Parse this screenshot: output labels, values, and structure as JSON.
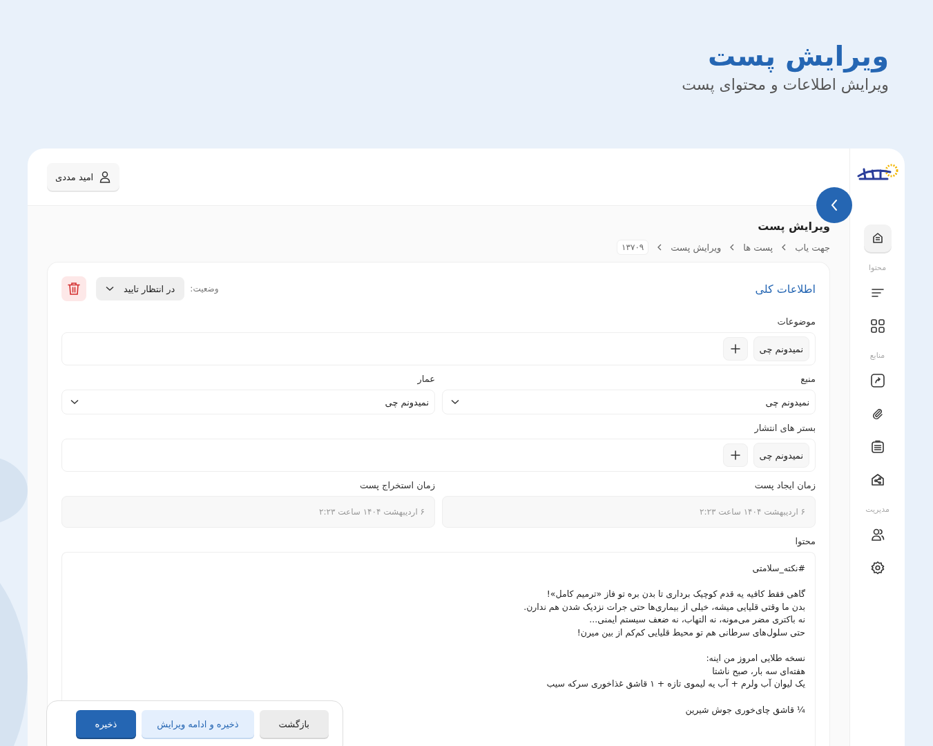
{
  "header": {
    "title": "ویرایش پست",
    "subtitle": "ویرایش اطلاعات و محتوای پست"
  },
  "sidebar": {
    "home": {
      "selected": true
    },
    "sections": [
      {
        "title": "محتوا",
        "items": [
          {
            "kind": "lines",
            "selected": false
          },
          {
            "kind": "grid",
            "selected": false
          }
        ]
      },
      {
        "title": "منابع",
        "items": [
          {
            "kind": "share",
            "selected": false
          },
          {
            "kind": "clip",
            "selected": false
          },
          {
            "kind": "list",
            "selected": false
          },
          {
            "kind": "house",
            "selected": false
          }
        ]
      },
      {
        "title": "مدیریت",
        "items": [
          {
            "kind": "users",
            "selected": false
          },
          {
            "kind": "gear",
            "selected": false
          }
        ]
      }
    ]
  },
  "user": {
    "name": "امید مددی"
  },
  "page": {
    "title": "ویرایش پست",
    "breadcrumb": [
      "جهت یاب",
      "پست ها",
      "ویرایش پست"
    ],
    "post_id": "۱۳۷۰۹"
  },
  "form": {
    "title": "اطلاعات کلی",
    "status": {
      "label": "وضعیت:",
      "value": "در انتظار تایید"
    },
    "rows": [
      [
        {
          "kind": "tags",
          "label": "موضوعات",
          "tags": [
            "نمیدونم چی"
          ]
        }
      ],
      [
        {
          "kind": "select",
          "label": "منبع",
          "value": "نمیدونم چی"
        },
        {
          "kind": "select",
          "label": "عمار",
          "value": "نمیدونم چی"
        }
      ],
      [
        {
          "kind": "tags",
          "label": "بستر های انتشار",
          "tags": [
            "نمیدونم چی"
          ]
        }
      ],
      [
        {
          "kind": "date",
          "label": "زمان ایجاد پست",
          "value": "۶ اردیبهشت ۱۴۰۴ ساعت ۲:۲۳",
          "disabled": true
        },
        {
          "kind": "date",
          "label": "زمان استخراج پست",
          "value": "۶ اردیبهشت ۱۴۰۴ ساعت ۲:۲۳",
          "disabled": true
        }
      ],
      [
        {
          "kind": "editor",
          "label": "محتوا",
          "paragraphs": [
            [
              "#نکته_سلامتی"
            ],
            [
              "گاهی فقط کافیه یه قدم کوچیک برداری تا بدن بره تو فاز «ترمیم کامل»!",
              "بدن ما وقتی قلیایی میشه، خیلی از بیماری‌ها حتی جرات نزدیک شدن هم ندارن.",
              "نه باکتری مضر می‌مونه، نه التهاب، نه ضعف سیستم ایمنی...",
              "حتی سلول‌های سرطانی هم تو محیط قلیایی کم‌کم از بین میرن!"
            ],
            [
              "نسخه طلایی امروز من اینه:",
              "هفته‌ای سه بار، صبح ناشتا",
              "یک لیوان آب ولرم + آب یه لیموی تازه + ۱ قاشق غذاخوری سرکه سیب"
            ],
            [
              "¼ قاشق چای‌خوری جوش شیرین"
            ]
          ]
        }
      ]
    ]
  },
  "footer": {
    "buttons": [
      {
        "kind": "secondary",
        "label": "بازگشت"
      },
      {
        "kind": "soft",
        "label": "ذخیره و ادامه ویرایش"
      },
      {
        "kind": "primary",
        "label": "ذخیره"
      }
    ]
  }
}
